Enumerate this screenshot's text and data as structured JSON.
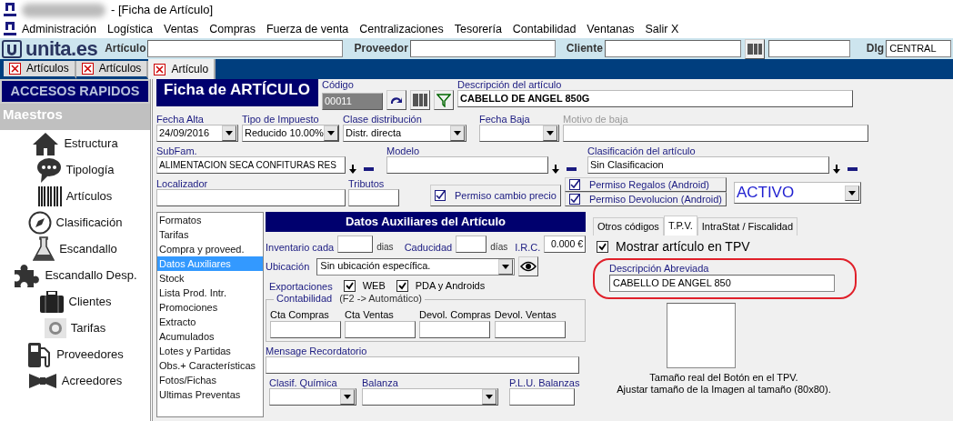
{
  "window": {
    "title": "- [Ficha de Artículo]"
  },
  "menu": [
    "Administración",
    "Logística",
    "Ventas",
    "Compras",
    "Fuerza de venta",
    "Centralizaciones",
    "Tesorería",
    "Contabilidad",
    "Ventanas",
    "Salir X"
  ],
  "toolbar": {
    "logo": "unita.es",
    "fields": [
      {
        "kind": "text",
        "label": "Artículo"
      },
      {
        "kind": "text",
        "label": "Proveedor"
      },
      {
        "kind": "text",
        "label": "Cliente"
      },
      {
        "kind": "barcode"
      },
      {
        "kind": "text",
        "label": "Dlg",
        "value": "CENTRAL"
      }
    ]
  },
  "tabs": [
    {
      "label": "Artículos",
      "selected": false
    },
    {
      "label": "Artículos",
      "selected": false
    },
    {
      "label": "Artículo",
      "selected": true
    }
  ],
  "sidebar": {
    "title": "ACCESOS RAPIDOS",
    "section": "Maestros",
    "items": [
      {
        "label": "Estructura"
      },
      {
        "label": "Tipología"
      },
      {
        "label": "Artículos"
      },
      {
        "label": "Clasificación"
      },
      {
        "label": "Escandallo"
      },
      {
        "label": "Escandallo Desp."
      },
      {
        "label": "Clientes"
      },
      {
        "label": "Tarifas"
      },
      {
        "label": "Proveedores"
      },
      {
        "label": "Acreedores"
      }
    ]
  },
  "form": {
    "title": "Ficha de ARTÍCULO",
    "code": {
      "label": "Código",
      "value": "00011"
    },
    "description": {
      "label": "Descripción del artículo",
      "value": "CABELLO DE ANGEL 850G"
    },
    "fecha_alta": {
      "label": "Fecha Alta",
      "value": "24/09/2016"
    },
    "tipo_impuesto": {
      "label": "Tipo de Impuesto",
      "value": "Reducido 10.00%"
    },
    "clase_distribucion": {
      "label": "Clase distribución",
      "value": "Distr. directa"
    },
    "fecha_baja": {
      "label": "Fecha Baja"
    },
    "motivo_baja": {
      "label": "Motivo de baja",
      "disabled": true
    },
    "subfam": {
      "label": "SubFam.",
      "value": "ALIMENTACION SECA CONFITURAS RES"
    },
    "modelo": {
      "label": "Modelo"
    },
    "clasificacion": {
      "label": "Clasificación del artículo",
      "value": "Sin Clasificacion"
    },
    "localizador": {
      "label": "Localizador"
    },
    "tributos": {
      "label": "Tributos"
    },
    "permisos": [
      {
        "label": "Permiso cambio precio",
        "checked": true
      },
      {
        "label": "Permiso Regalos (Android)",
        "checked": true
      },
      {
        "label": "Permiso Devolucion (Android)",
        "checked": true
      }
    ],
    "estado": {
      "value": "ACTIVO"
    }
  },
  "sections": [
    {
      "label": "Formatos",
      "selected": false
    },
    {
      "label": "Tarifas",
      "selected": false
    },
    {
      "label": "Compra y proveed.",
      "selected": false
    },
    {
      "label": "Datos Auxiliares",
      "selected": true
    },
    {
      "label": "Stock",
      "selected": false
    },
    {
      "label": "Lista Prod. Intr.",
      "selected": false
    },
    {
      "label": "Promociones",
      "selected": false
    },
    {
      "label": "Extracto",
      "selected": false
    },
    {
      "label": "Acumulados",
      "selected": false
    },
    {
      "label": "Lotes y Partidas",
      "selected": false
    },
    {
      "label": "Obs.+ Características",
      "selected": false
    },
    {
      "label": "Fotos/Fichas",
      "selected": false
    },
    {
      "label": "Ultimas Preventas",
      "selected": false
    }
  ],
  "aux": {
    "title": "Datos Auxiliares del Artículo",
    "inventario": {
      "label": "Inventario cada",
      "unit": "dias"
    },
    "caducidad": {
      "label": "Caducidad",
      "unit": "días"
    },
    "irc": {
      "label": "I.R.C.",
      "value": "0.000 €"
    },
    "ubicacion": {
      "label": "Ubicación",
      "value": "Sin ubicación específica."
    },
    "exportaciones": {
      "label": "Exportaciones",
      "options": [
        {
          "label": "WEB",
          "checked": true
        },
        {
          "label": "PDA y Androids",
          "checked": true
        }
      ]
    },
    "contabilidad": {
      "title": "Contabilidad",
      "hint": "(F2 -> Automático)",
      "fields": [
        "Cta Compras",
        "Cta Ventas",
        "Devol. Compras",
        "Devol. Ventas"
      ]
    },
    "mensaje": {
      "label": "Mensage Recordatorio"
    },
    "clasif_quimica": {
      "label": "Clasif. Química"
    },
    "balanza": {
      "label": "Balanza"
    },
    "plu": {
      "label": "P.L.U. Balanzas"
    }
  },
  "tpv": {
    "tabs": [
      {
        "label": "Otros códigos",
        "selected": false
      },
      {
        "label": "T.P.V.",
        "selected": true
      },
      {
        "label": "IntraStat / Fiscalidad",
        "selected": false
      }
    ],
    "mostrar": {
      "label": "Mostrar artículo en TPV",
      "checked": true
    },
    "abreviada": {
      "label": "Descripción Abreviada",
      "value": "CABELLO DE ANGEL 850",
      "highlighted": true
    },
    "note": [
      "Tamaño real del Botón en el TPV.",
      "Ajustar tamaño de la Imagen al tamaño (80x80)."
    ]
  }
}
